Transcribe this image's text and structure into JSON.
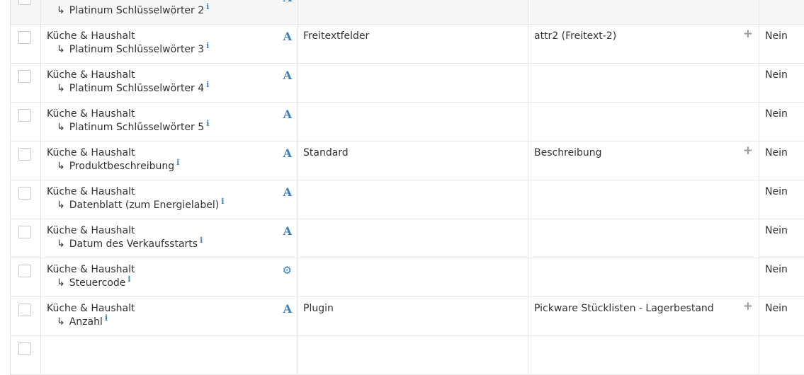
{
  "rows": [
    {
      "category": "Küche & Haushalt",
      "attribute": "Platinum Schlüsselwörter 2",
      "type_icon": "text-type-icon",
      "type_glyph": "A",
      "source": "",
      "field": "",
      "has_add": false,
      "required": "Nein"
    },
    {
      "category": "Küche & Haushalt",
      "attribute": "Platinum Schlüsselwörter 3",
      "type_icon": "text-type-icon",
      "type_glyph": "A",
      "source": "Freitextfelder",
      "field": "attr2 (Freitext-2)",
      "has_add": true,
      "required": "Nein"
    },
    {
      "category": "Küche & Haushalt",
      "attribute": "Platinum Schlüsselwörter 4",
      "type_icon": "text-type-icon",
      "type_glyph": "A",
      "source": "",
      "field": "",
      "has_add": false,
      "required": "Nein"
    },
    {
      "category": "Küche & Haushalt",
      "attribute": "Platinum Schlüsselwörter 5",
      "type_icon": "text-type-icon",
      "type_glyph": "A",
      "source": "",
      "field": "",
      "has_add": false,
      "required": "Nein"
    },
    {
      "category": "Küche & Haushalt",
      "attribute": "Produktbeschreibung",
      "type_icon": "text-type-icon",
      "type_glyph": "A",
      "source": "Standard",
      "field": "Beschreibung",
      "has_add": true,
      "required": "Nein"
    },
    {
      "category": "Küche & Haushalt",
      "attribute": "Datenblatt (zum Energielabel)",
      "type_icon": "text-type-icon",
      "type_glyph": "A",
      "source": "",
      "field": "",
      "has_add": false,
      "required": "Nein"
    },
    {
      "category": "Küche & Haushalt",
      "attribute": "Datum des Verkaufsstarts",
      "type_icon": "text-type-icon",
      "type_glyph": "A",
      "source": "",
      "field": "",
      "has_add": false,
      "required": "Nein"
    },
    {
      "category": "Küche & Haushalt",
      "attribute": "Steuercode",
      "type_icon": "cubes-type-icon",
      "type_glyph": "⚙",
      "source": "",
      "field": "",
      "has_add": false,
      "required": "Nein"
    },
    {
      "category": "Küche & Haushalt",
      "attribute": "Anzahl",
      "type_icon": "text-type-icon",
      "type_glyph": "A",
      "source": "Plugin",
      "field": "Pickware Stücklisten - Lagerbestand",
      "has_add": true,
      "required": "Nein"
    }
  ],
  "glyphs": {
    "arrow": "↳",
    "info": "i",
    "add": "+"
  }
}
